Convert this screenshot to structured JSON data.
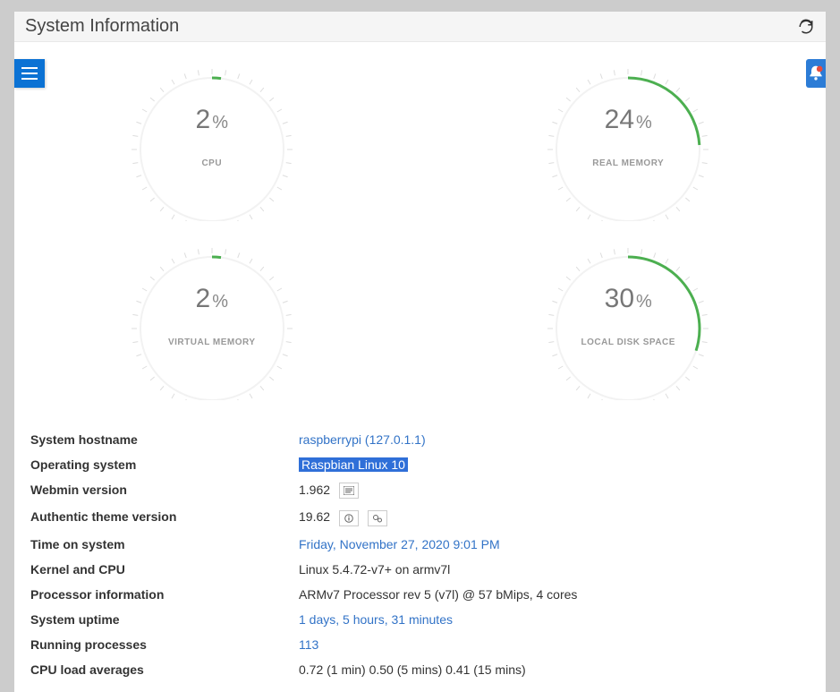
{
  "header": {
    "title": "System Information"
  },
  "gauges": [
    {
      "value": "2",
      "unit": "%",
      "label": "CPU",
      "percent": 2
    },
    {
      "value": "24",
      "unit": "%",
      "label": "REAL MEMORY",
      "percent": 24
    },
    {
      "value": "2",
      "unit": "%",
      "label": "VIRTUAL MEMORY",
      "percent": 2
    },
    {
      "value": "30",
      "unit": "%",
      "label": "LOCAL DISK SPACE",
      "percent": 30
    }
  ],
  "info": {
    "hostname_label": "System hostname",
    "hostname_value": "raspberrypi (127.0.1.1)",
    "os_label": "Operating system",
    "os_value": "Raspbian Linux 10",
    "webmin_label": "Webmin version",
    "webmin_value": "1.962",
    "theme_label": "Authentic theme version",
    "theme_value": "19.62",
    "time_label": "Time on system",
    "time_value": "Friday, November 27, 2020 9:01 PM",
    "kernel_label": "Kernel and CPU",
    "kernel_value": "Linux 5.4.72-v7+ on armv7l",
    "proc_label": "Processor information",
    "proc_value": "ARMv7 Processor rev 5 (v7l) @ 57 bMips, 4 cores",
    "uptime_label": "System uptime",
    "uptime_value": "1 days, 5 hours, 31 minutes",
    "running_label": "Running processes",
    "running_value": "113",
    "load_label": "CPU load averages",
    "load_value": "0.72 (1 min) 0.50 (5 mins) 0.41 (15 mins)"
  }
}
